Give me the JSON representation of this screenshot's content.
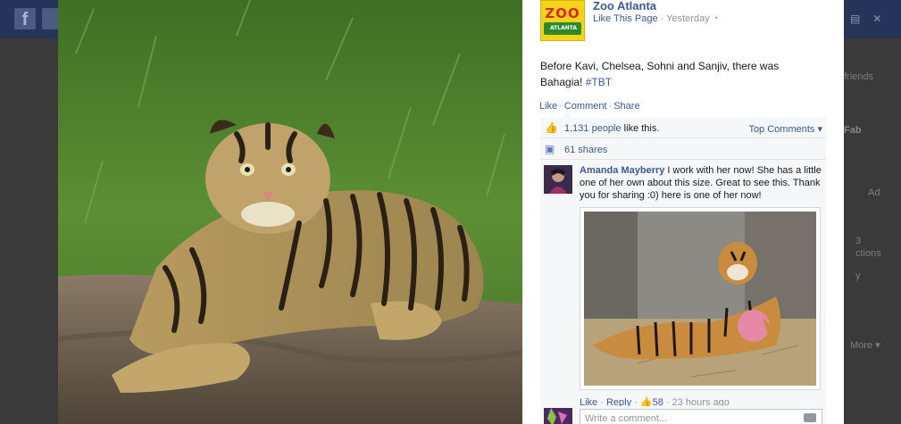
{
  "background": {
    "nav_logo": "f",
    "side_texts": [
      "friends",
      "Fab",
      "Ad",
      "3",
      "ctions",
      "y",
      "More"
    ]
  },
  "post": {
    "page_name": "Zoo Atlanta",
    "avatar_line1": "ZOO",
    "avatar_line2": "ATLANTA",
    "like_page": "Like This Page",
    "time": "Yesterday",
    "text": "Before Kavi, Chelsea, Sohni and Sanjiv, there was Bahagia!",
    "hashtag": "#TBT",
    "actions": {
      "like": "Like",
      "comment": "Comment",
      "share": "Share"
    },
    "likes_count": "1,131 people",
    "likes_suffix": " like this.",
    "top_comments": "Top Comments",
    "shares": "61 shares"
  },
  "comment": {
    "author": "Amanda Mayberry",
    "text": " I work with her now! She has a little one of her own about this size. Great to see this. Thank you for sharing :0) here is one of her now!",
    "like": "Like",
    "reply": "Reply",
    "likes": "58",
    "time": "23 hours ago"
  },
  "composer": {
    "placeholder": "Write a comment..."
  },
  "colors": {
    "link": "#3b5998",
    "nav": "#27345a",
    "zoo_yellow": "#f6d31b",
    "zoo_red": "#d9281c"
  }
}
